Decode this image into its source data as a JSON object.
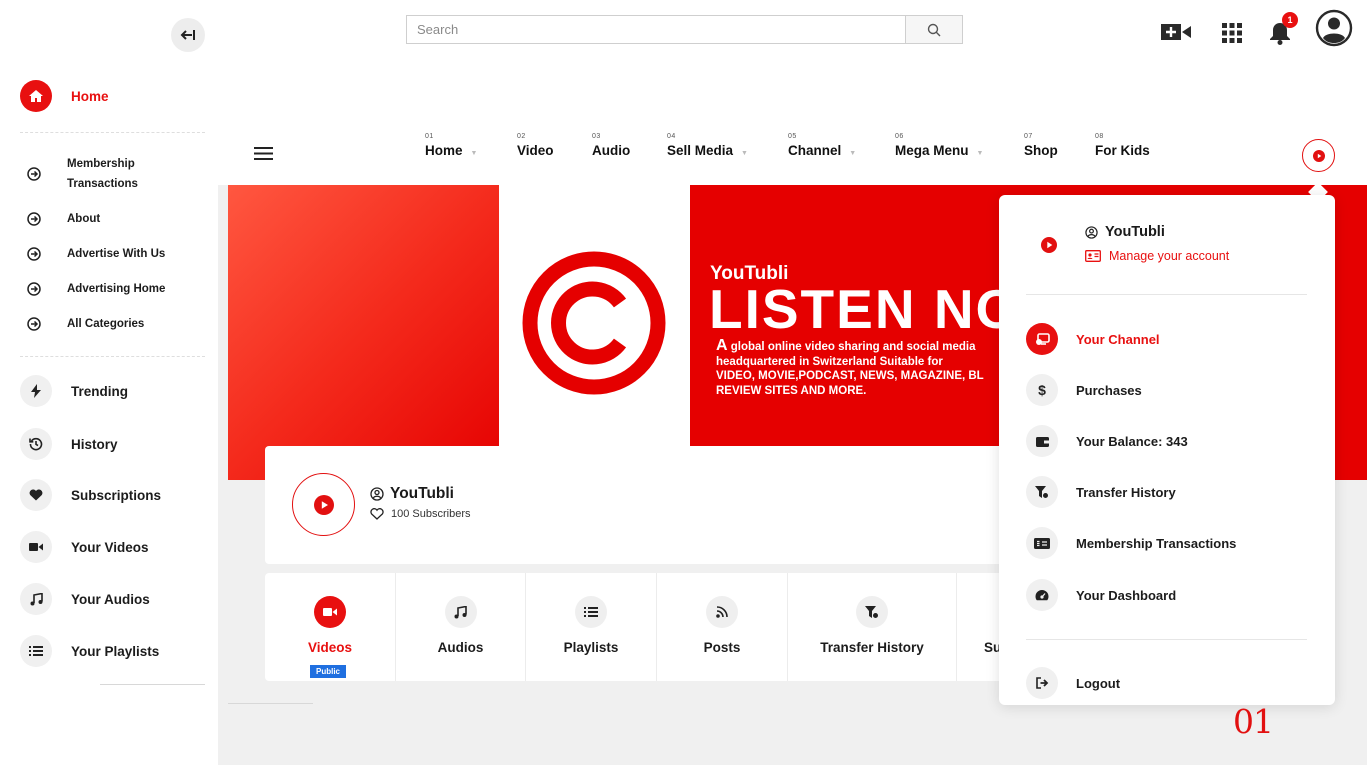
{
  "topbar": {
    "search_placeholder": "Search",
    "notification_count": "1"
  },
  "sidebar": {
    "home": "Home",
    "links": [
      "Membership Transactions",
      "About",
      "Advertise With Us",
      "Advertising Home",
      "All Categories"
    ],
    "items": [
      {
        "label": "Trending",
        "icon": "bolt-icon"
      },
      {
        "label": "History",
        "icon": "history-icon"
      },
      {
        "label": "Subscriptions",
        "icon": "heart-icon"
      },
      {
        "label": "Your Videos",
        "icon": "video-icon"
      },
      {
        "label": "Your Audios",
        "icon": "music-icon"
      },
      {
        "label": "Your Playlists",
        "icon": "list-icon"
      }
    ]
  },
  "nav": {
    "items": [
      {
        "num": "01",
        "label": "Home"
      },
      {
        "num": "02",
        "label": "Video"
      },
      {
        "num": "03",
        "label": "Audio"
      },
      {
        "num": "04",
        "label": "Sell Media"
      },
      {
        "num": "05",
        "label": "Channel"
      },
      {
        "num": "06",
        "label": "Mega Menu"
      },
      {
        "num": "07",
        "label": "Shop"
      },
      {
        "num": "08",
        "label": "For Kids"
      }
    ]
  },
  "banner": {
    "brand": "YouTubli",
    "headline": "LISTEN NO",
    "desc_cap": "A",
    "desc_rest": " global online video sharing and social media",
    "desc_line2": "headquartered in Switzerland Suitable for",
    "desc_line3": "VIDEO, MOVIE,PODCAST, NEWS, MAGAZINE, BL",
    "desc_line4": "REVIEW SITES AND MORE."
  },
  "channel": {
    "name": "YouTubli",
    "subscribers": "100 Subscribers"
  },
  "tabs": [
    {
      "label": "Videos",
      "icon": "video-icon",
      "badge": "Public"
    },
    {
      "label": "Audios",
      "icon": "music-icon"
    },
    {
      "label": "Playlists",
      "icon": "list-icon"
    },
    {
      "label": "Posts",
      "icon": "rss-icon"
    },
    {
      "label": "Transfer History",
      "icon": "funnel-icon"
    },
    {
      "label": "Su",
      "icon": ""
    }
  ],
  "account_menu": {
    "username": "YouTubli",
    "manage": "Manage your account",
    "items": [
      {
        "label": "Your Channel",
        "icon": "channel-icon"
      },
      {
        "label": "Purchases",
        "icon": "dollar-icon"
      },
      {
        "label": "Your Balance: 343",
        "icon": "wallet-icon"
      },
      {
        "label": "Transfer History",
        "icon": "funnel-icon"
      },
      {
        "label": "Membership Transactions",
        "icon": "money-bill-icon"
      },
      {
        "label": "Your Dashboard",
        "icon": "dashboard-icon"
      }
    ],
    "logout": "Logout"
  },
  "page_number": "01",
  "colors": {
    "accent": "#e81010",
    "link_blue": "#1f6fe0"
  }
}
